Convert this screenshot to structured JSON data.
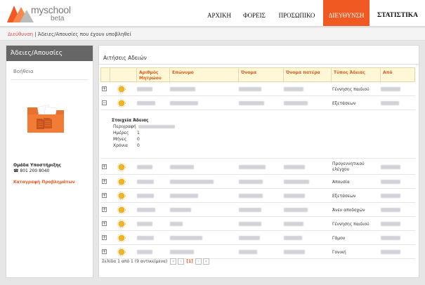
{
  "header": {
    "brand": "myschool",
    "tag": "beta",
    "nav": [
      {
        "label": "ΑΡΧΙΚΗ"
      },
      {
        "label": "ΦΟΡΕΙΣ"
      },
      {
        "label": "ΠΡΟΣΩΠΙΚΟ"
      },
      {
        "label": "ΔΙΕΥΘΥΝΣΗ"
      },
      {
        "label": "ΣΤΑΤΙΣΤΙΚΑ"
      }
    ],
    "active_index": 3
  },
  "breadcrumb": {
    "home": "Διεύθυνση",
    "separator": " | ",
    "current": "Άδειες/Απουσίες που έχουν υποβληθεί"
  },
  "sidebar": {
    "title": "Άδειες/Απουσίες",
    "help": "Βοήθεια",
    "support_title": "Ομάδα Υποστήριξης",
    "support_phone": "801 200 8040",
    "report_link": "Καταγραφή Προβλημάτων"
  },
  "main": {
    "title": "Αιτήσεις Αδειών",
    "columns": [
      "Αριθμός Μητρώου",
      "Επώνυμο",
      "Όνομα",
      "Όνομα πατέρα",
      "Τύπος Άδειας",
      "Από"
    ],
    "rows": [
      {
        "expander": "+",
        "type": "Γέννησης παιδιού"
      },
      {
        "expander": "−",
        "type": "Εξετάσεων"
      },
      {
        "expander": "+",
        "type": "Προγεννητικού ελέγχου"
      },
      {
        "expander": "+",
        "type": "Απουσία"
      },
      {
        "expander": "+",
        "type": "Εξετάσεων"
      },
      {
        "expander": "+",
        "type": "Άνευ αποδοχών"
      },
      {
        "expander": "+",
        "type": "Γέννησης παιδιού"
      },
      {
        "expander": "+",
        "type": "Γάμου"
      },
      {
        "expander": "+",
        "type": "Γονική"
      }
    ],
    "details": {
      "title": "Στοιχεία Άδειας",
      "labels": [
        "Περιγραφή",
        "Ημέρες",
        "Μήνες",
        "Χρόνια"
      ],
      "values": [
        "",
        "1",
        "0",
        "0"
      ]
    },
    "pager": {
      "summary": "Σελίδα 1 από 1 (9 αντικείμενα)",
      "current_page": "[1]"
    }
  },
  "colors": {
    "accent": "#f05a22",
    "header_row_bg": "#fff7d6",
    "sidebar_title_bg": "#666666"
  }
}
